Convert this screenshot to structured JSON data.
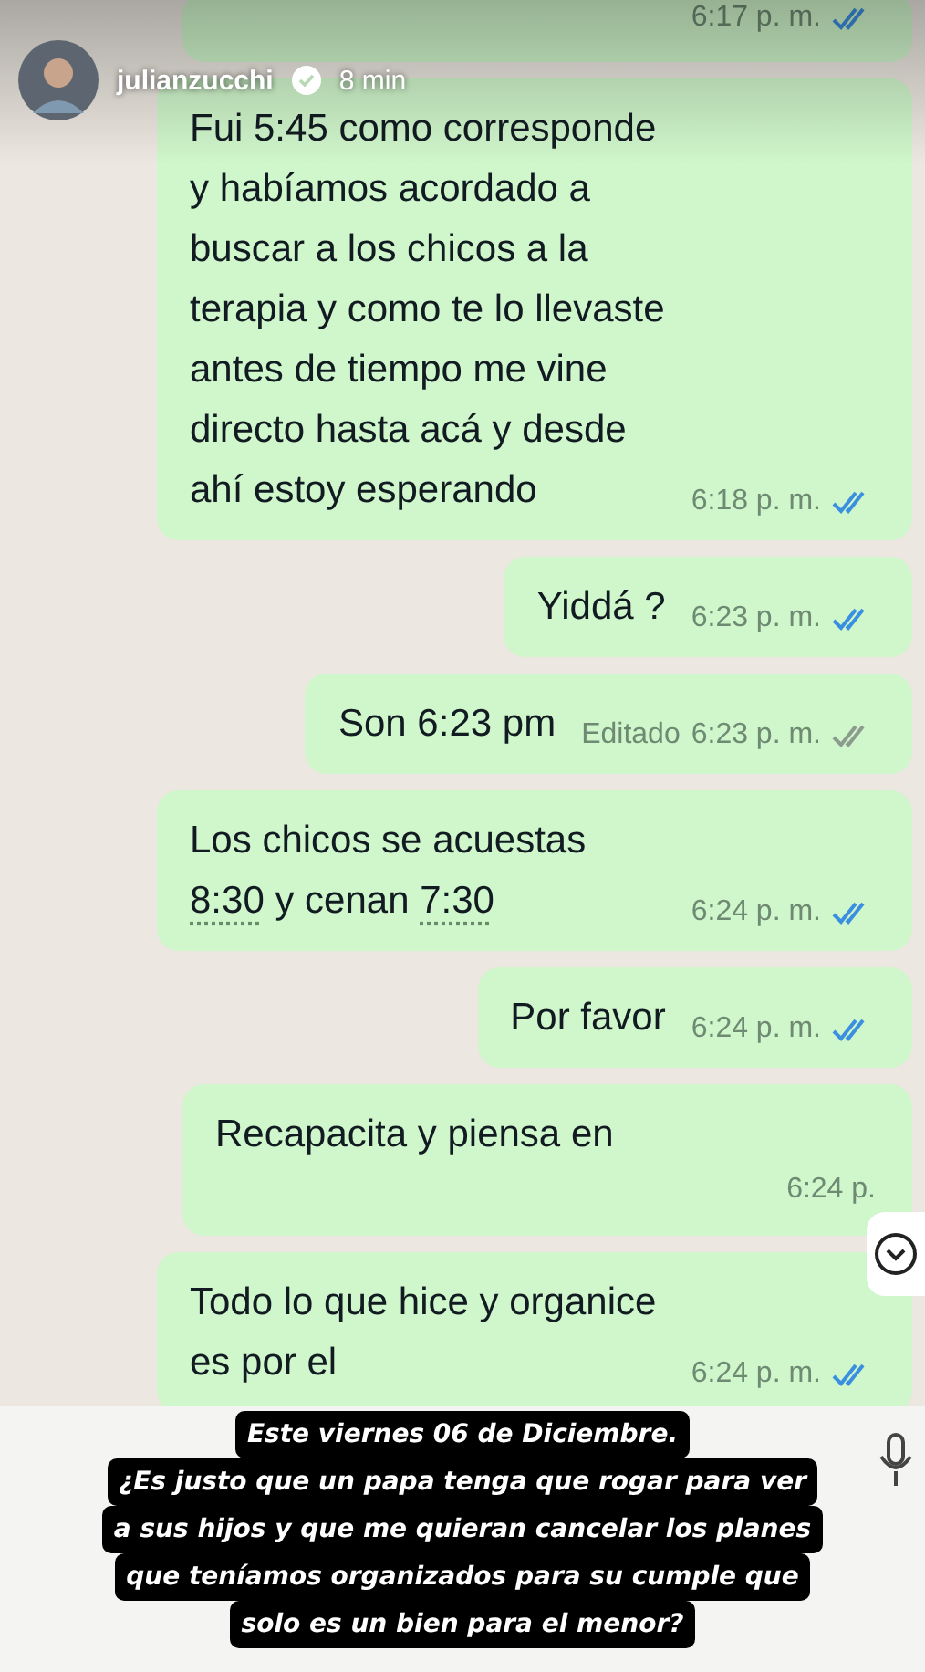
{
  "story_header": {
    "username": "julianzucchi",
    "verified": true,
    "age": "8 min"
  },
  "messages": [
    {
      "kind": "partial",
      "time": "6:17 p. m.",
      "read": true
    },
    {
      "kind": "full",
      "parts": [
        {
          "kind": "plain",
          "text": "Fui 5:45 como corresponde y habíamos acordado a buscar a los chicos a la terapia y como te lo llevaste antes de tiempo me vine directo hasta acá y desde ahí estoy esperando"
        }
      ],
      "time": "6:18 p. m.",
      "read": true
    },
    {
      "kind": "full",
      "parts": [
        {
          "kind": "plain",
          "text": "Yiddá ?"
        }
      ],
      "time": "6:23 p. m.",
      "read": true
    },
    {
      "kind": "full",
      "parts": [
        {
          "kind": "plain",
          "text": "Son 6:23 pm"
        }
      ],
      "edited": "Editado",
      "time": "6:23 p. m.",
      "read": false
    },
    {
      "kind": "full",
      "parts": [
        {
          "kind": "plain",
          "text": "Los chicos se acuestas "
        },
        {
          "kind": "link",
          "text": "8:30"
        },
        {
          "kind": "plain",
          "text": " y cenan "
        },
        {
          "kind": "link",
          "text": "7:30"
        }
      ],
      "time": "6:24 p. m.",
      "read": true
    },
    {
      "kind": "full",
      "parts": [
        {
          "kind": "plain",
          "text": "Por favor"
        }
      ],
      "time": "6:24 p. m.",
      "read": true
    },
    {
      "kind": "covered",
      "parts": [
        {
          "kind": "plain",
          "text": "Recapacita y piensa en"
        }
      ],
      "time": "6:24 p."
    },
    {
      "kind": "full",
      "parts": [
        {
          "kind": "plain",
          "text": "Todo lo que hice y organice es por el"
        }
      ],
      "time": "6:24 p. m.",
      "read": true
    }
  ],
  "caption": [
    "Este viernes 06 de Diciembre.",
    "¿Es justo que un papa tenga que rogar para ver",
    "a sus hijos y que me quieran cancelar los planes",
    "que teníamos organizados para su cumple que",
    "solo es un bien para el menor?"
  ]
}
